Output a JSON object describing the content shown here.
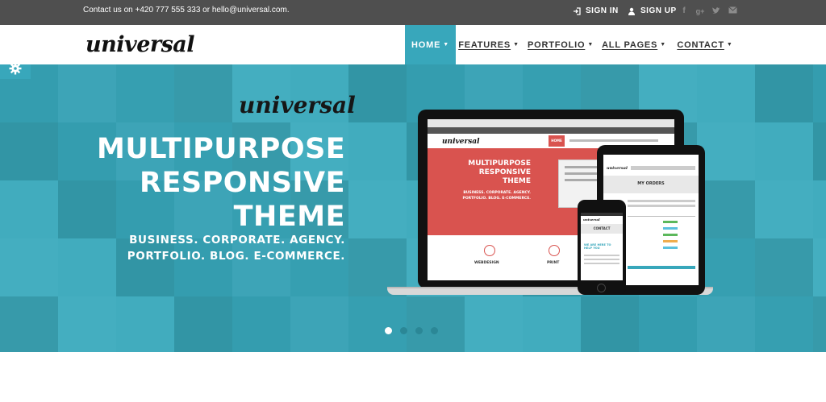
{
  "topbar": {
    "contact_text": "Contact us on +420 777 555 333 or hello@universal.com.",
    "sign_in": "SIGN IN",
    "sign_up": "SIGN UP",
    "social_icons": [
      "facebook-icon",
      "google-plus-icon",
      "twitter-icon",
      "email-icon"
    ]
  },
  "nav": {
    "logo": "universal",
    "items": [
      {
        "label": "HOME",
        "active": true
      },
      {
        "label": "FEATURES",
        "active": false
      },
      {
        "label": "PORTFOLIO",
        "active": false
      },
      {
        "label": "ALL PAGES",
        "active": false
      },
      {
        "label": "CONTACT",
        "active": false
      }
    ]
  },
  "hero": {
    "logo": "universal",
    "title_lines": [
      "MULTIPURPOSE",
      "RESPONSIVE",
      "THEME"
    ],
    "subtitle_lines": [
      "BUSINESS. CORPORATE. AGENCY.",
      "PORTFOLIO. BLOG. E-COMMERCE."
    ],
    "laptop_screen": {
      "logo": "universal",
      "nav_active": "HOME",
      "title_lines": [
        "MULTIPURPOSE",
        "RESPONSIVE",
        "THEME"
      ],
      "subtitle_lines": [
        "BUSINESS. CORPORATE. AGENCY.",
        "PORTFOLIO. BLOG. E-COMMERCE."
      ],
      "features": [
        "WEBDESIGN",
        "PRINT"
      ]
    },
    "tablet_screen": {
      "logo": "universal",
      "heading": "MY ORDERS"
    },
    "phone_screen": {
      "logo": "universal",
      "heading": "CONTACT",
      "text": "WE ARE HERE TO HELP YOU"
    },
    "slider_dots": [
      true,
      false,
      false,
      false
    ]
  },
  "colors": {
    "accent": "#38a7bb",
    "topbar": "#4f4f4f",
    "hero_bg": "#3aa6b9",
    "hero_tile_dark": "#2b8796",
    "laptop_red": "#d9534f"
  }
}
